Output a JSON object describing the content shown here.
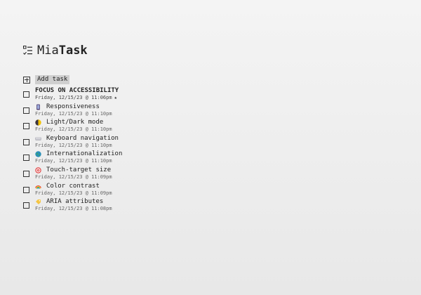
{
  "brand": {
    "name_light": "Mia",
    "name_bold": "Task"
  },
  "add_task_label": "Add task",
  "tasks": [
    {
      "title": "FOCUS ON ACCESSIBILITY",
      "date": "Friday, 12/15/23 @ 11:06pm",
      "starred": true,
      "icon": ""
    },
    {
      "title": "Responsiveness",
      "date": "Friday, 12/15/23 @ 11:10pm",
      "icon": "mobile-phone-icon"
    },
    {
      "title": "Light/Dark mode",
      "date": "Friday, 12/15/23 @ 11:10pm",
      "icon": "half-moon-icon"
    },
    {
      "title": "Keyboard navigation",
      "date": "Friday, 12/15/23 @ 11:10pm",
      "icon": "keyboard-icon"
    },
    {
      "title": "Internationalization",
      "date": "Friday, 12/15/23 @ 11:10pm",
      "icon": "globe-icon"
    },
    {
      "title": "Touch-target size",
      "date": "Friday, 12/15/23 @ 11:09pm",
      "icon": "target-icon"
    },
    {
      "title": "Color contrast",
      "date": "Friday, 12/15/23 @ 11:09pm",
      "icon": "rainbow-icon"
    },
    {
      "title": "ARIA attributes",
      "date": "Friday, 12/15/23 @ 11:08pm",
      "icon": "label-tag-icon"
    }
  ],
  "star_glyph": "★"
}
